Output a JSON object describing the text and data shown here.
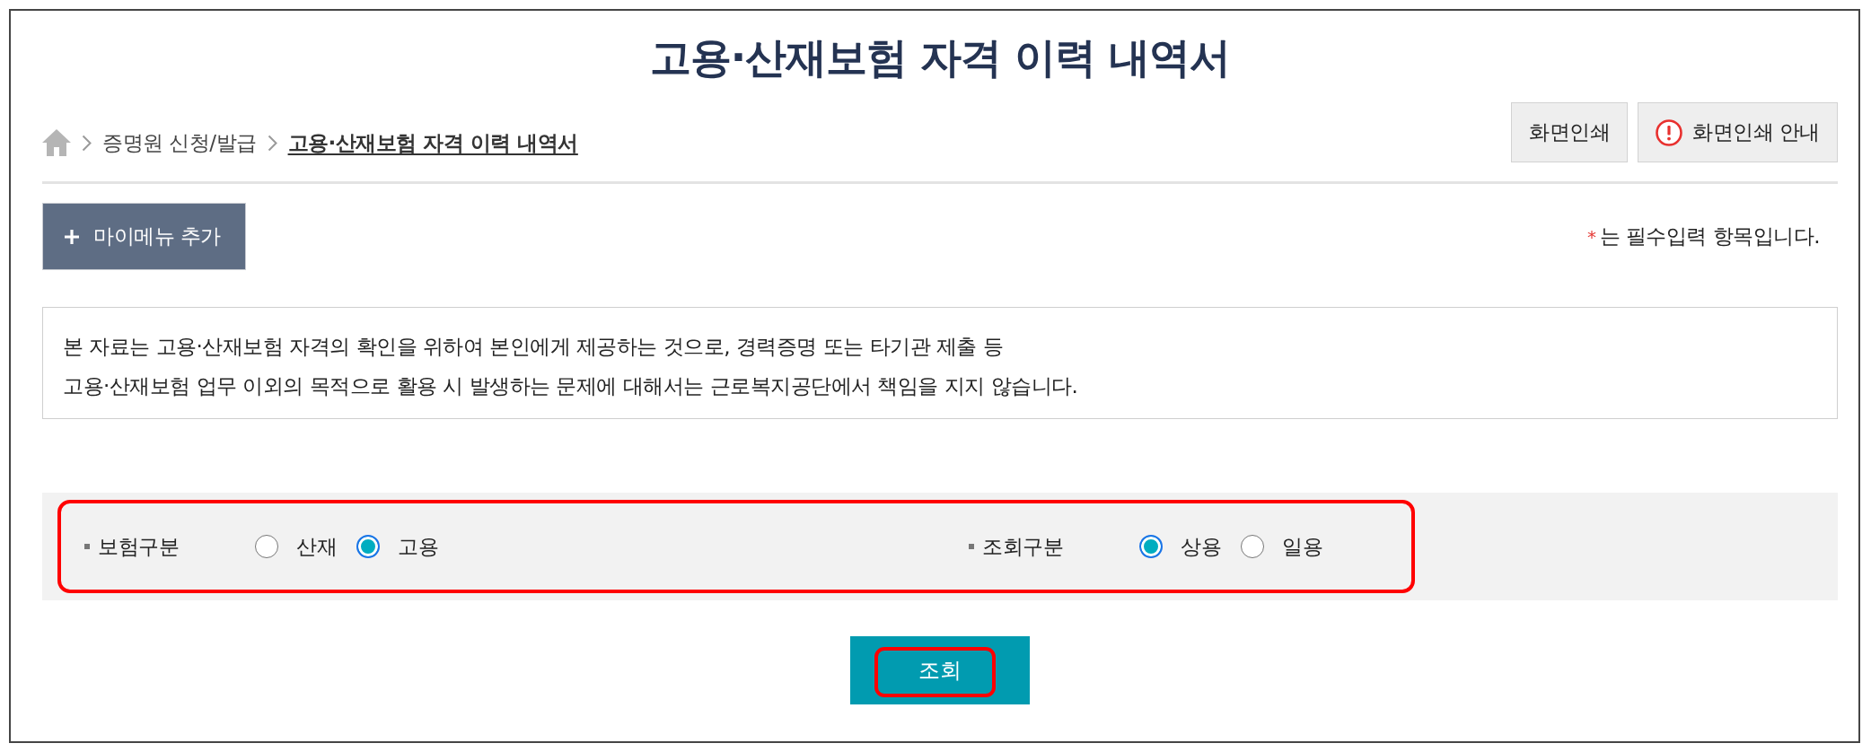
{
  "title": "고용·산재보험 자격 이력 내역서",
  "breadcrumb": {
    "items": [
      {
        "label": "증명원 신청/발급",
        "current": false
      },
      {
        "label": "고용·산재보험 자격 이력 내역서",
        "current": true
      }
    ]
  },
  "print_buttons": [
    {
      "label": "화면인쇄",
      "kind": "plain"
    },
    {
      "label": "화면인쇄 안내",
      "kind": "alert"
    }
  ],
  "mymenu_button": {
    "label": "마이메뉴 추가"
  },
  "required_note": {
    "mark": "*",
    "text": "는 필수입력 항목입니다."
  },
  "notice": {
    "lines": [
      "본 자료는 고용·산재보험 자격의 확인을 위하여 본인에게 제공하는 것으로, 경력증명 또는 타기관 제출 등",
      "고용·산재보험 업무 이외의 목적으로 활용 시 발생하는 문제에 대해서는 근로복지공단에서 책임을 지지 않습니다."
    ]
  },
  "filter_panel": {
    "highlighted": true,
    "groups": [
      {
        "label": "보험구분",
        "options": [
          {
            "label": "산재",
            "selected": false
          },
          {
            "label": "고용",
            "selected": true
          }
        ]
      },
      {
        "label": "조회구분",
        "options": [
          {
            "label": "상용",
            "selected": true
          },
          {
            "label": "일용",
            "selected": false
          }
        ]
      }
    ]
  },
  "search_button": {
    "label": "조회",
    "highlighted": true
  }
}
